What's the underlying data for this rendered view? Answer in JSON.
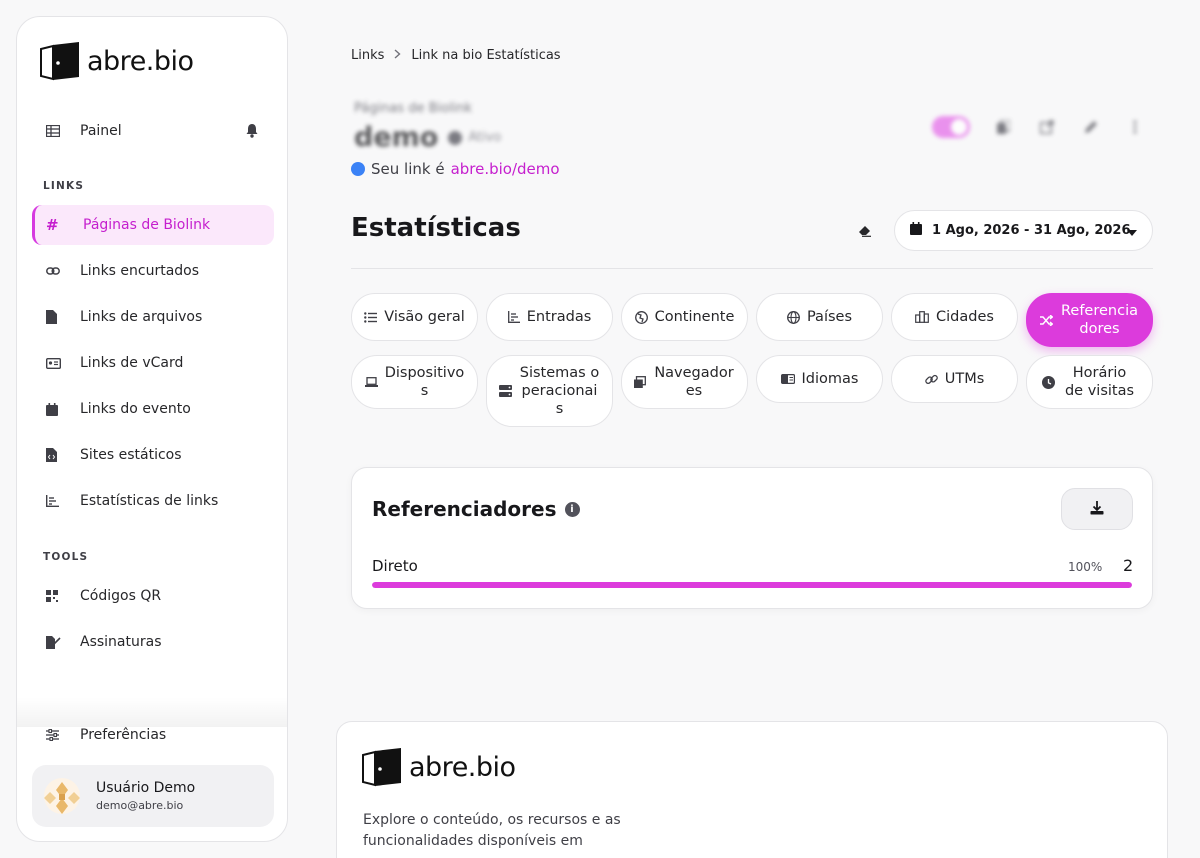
{
  "brand": {
    "name": "abre.bio"
  },
  "sidebar": {
    "dashboard_label": "Painel",
    "links_section": "LINKS",
    "tools_section": "TOOLS",
    "items": [
      {
        "label": "Páginas de Biolink",
        "icon": "hash-icon",
        "active": true
      },
      {
        "label": "Links encurtados",
        "icon": "link-icon"
      },
      {
        "label": "Links de arquivos",
        "icon": "file-icon"
      },
      {
        "label": "Links de vCard",
        "icon": "id-card-icon"
      },
      {
        "label": "Links do evento",
        "icon": "calendar-icon"
      },
      {
        "label": "Sites estáticos",
        "icon": "file-code-icon"
      },
      {
        "label": "Estatísticas de links",
        "icon": "chart-icon"
      }
    ],
    "tools": [
      {
        "label": "Códigos QR",
        "icon": "qr-icon"
      },
      {
        "label": "Assinaturas",
        "icon": "signature-icon"
      }
    ],
    "preferences_label": "Preferências",
    "user": {
      "name": "Usuário Demo",
      "email": "demo@abre.bio"
    }
  },
  "breadcrumb": {
    "root": "Links",
    "current": "Link na bio Estatísticas"
  },
  "page": {
    "subtitle": "Páginas de Biolink",
    "title": "demo",
    "status": "Ativo",
    "link_prefix": "Seu link é",
    "link_url": "abre.bio/demo",
    "toggle_on": true
  },
  "stats": {
    "title": "Estatísticas",
    "date_range": "1 Ago, 2026 - 31 Ago, 2026"
  },
  "tabs": [
    {
      "label": "Visão geral",
      "icon": "list-icon"
    },
    {
      "label": "Entradas",
      "icon": "chart-bar-icon"
    },
    {
      "label": "Continente",
      "icon": "globe-europe-icon"
    },
    {
      "label": "Países",
      "icon": "globe-icon"
    },
    {
      "label": "Cidades",
      "icon": "city-icon"
    },
    {
      "label": "Referenciadores",
      "icon": "random-icon",
      "active": true
    },
    {
      "label": "Dispositivos",
      "icon": "laptop-icon"
    },
    {
      "label": "Sistemas operacionais",
      "icon": "server-icon"
    },
    {
      "label": "Navegadores",
      "icon": "window-icon"
    },
    {
      "label": "Idiomas",
      "icon": "language-icon"
    },
    {
      "label": "UTMs",
      "icon": "link-icon"
    },
    {
      "label": "Horário de visitas",
      "icon": "clock-icon"
    }
  ],
  "referrers": {
    "title": "Referenciadores",
    "rows": [
      {
        "label": "Direto",
        "percent": "100%",
        "count": "2",
        "fill": 1.0
      }
    ]
  },
  "footer": {
    "text": "Explore o conteúdo, os recursos e as funcionalidades disponíveis em"
  },
  "colors": {
    "accent": "#dc3bdc",
    "link_dot": "#3b82f6"
  }
}
